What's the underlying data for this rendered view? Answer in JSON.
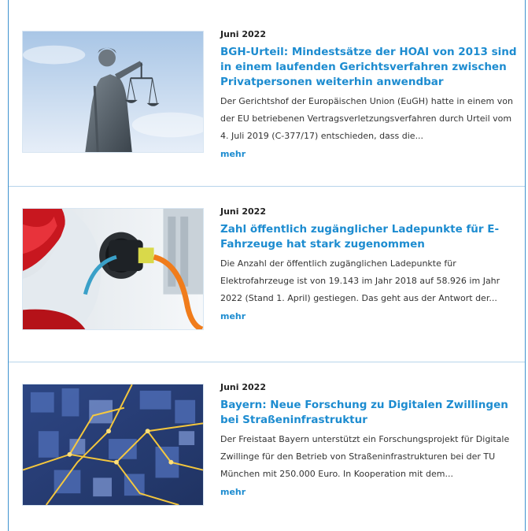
{
  "articles": [
    {
      "date": "Juni 2022",
      "title": "BGH-Urteil: Mindestsätze der HOAI von 2013 sind in einem laufenden Gerichtsverfahren zwischen Privatpersonen weiterhin anwendbar",
      "teaser": "Der Gerichtshof der Europäischen Union (EuGH) hatte in einem von der EU betriebenen Vertragsverletzungsverfahren durch Urteil vom 4. Juli 2019 (C-377/17) entschieden, dass die...",
      "more": "mehr",
      "image_icon": "justitia-statue-image"
    },
    {
      "date": "Juni 2022",
      "title": "Zahl öffentlich zugänglicher Ladepunkte für E-Fahrzeuge hat stark zugenommen",
      "teaser": "Die Anzahl der öffentlich zugänglichen Ladepunkte für Elektrofahrzeuge ist von 19.143 im Jahr 2018 auf 58.926 im Jahr 2022 (Stand 1. April) gestiegen. Das geht aus der Antwort der...",
      "more": "mehr",
      "image_icon": "ev-charging-image"
    },
    {
      "date": "Juni 2022",
      "title": "Bayern: Neue Forschung zu Digitalen Zwillingen bei Straßeninfrastruktur",
      "teaser": "Der Freistaat Bayern unterstützt ein Forschungsprojekt für Digitale Zwillinge für den Betrieb von Straßeninfrastrukturen bei der TU München mit 250.000 Euro. In Kooperation mit dem...",
      "more": "mehr",
      "image_icon": "digital-city-image"
    }
  ],
  "colors": {
    "accent": "#1d8cd0",
    "frame": "#3f93cf",
    "divider": "#b7d4ea"
  }
}
